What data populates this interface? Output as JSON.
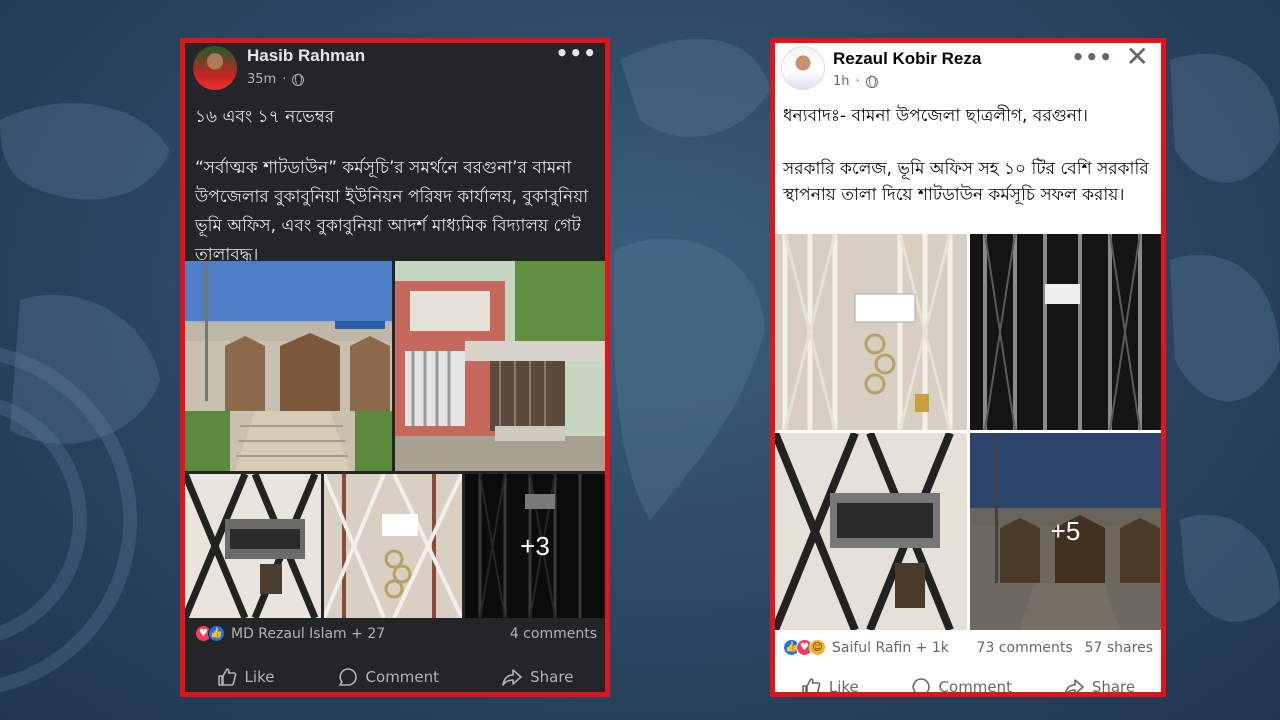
{
  "post1": {
    "author": "Hasib Rahman",
    "time": "35m",
    "paragraphs": [
      "১৬ এবং ১৭ নভেম্বর",
      "“সর্বাত্মক শাটডাউন” কর্মসূচি’র সমর্থনে বরগুনা’র বামনা উপজেলার বুকাবুনিয়া ইউনিয়ন পরিষদ কার্যালয়, বুকাবুনিয়া ভূমি অফিস, এবং বুকাবুনিয়া আদর্শ মাধ্যমিক বিদ্যালয় গেট তালাবদ্ধ।"
    ],
    "more_photos": "+3",
    "reactions_text": "MD Rezaul Islam + 27",
    "comments": "4 comments",
    "actions": {
      "like": "Like",
      "comment": "Comment",
      "share": "Share"
    }
  },
  "post2": {
    "author": "Rezaul Kobir Reza",
    "time": "1h",
    "paragraphs": [
      "ধন্যবাদঃ- বামনা উপজেলা ছাত্রলীগ, বরগুনা।",
      "সরকারি কলেজ, ভূমি অফিস সহ ১০ টির বেশি সরকারি স্থাপনায় তালা দিয়ে শাটডাউন কর্মসূচি সফল করায়।"
    ],
    "more_photos": "+5",
    "reactions_text": "Saiful Rafin + 1k",
    "comments": "73 comments",
    "shares": "57 shares",
    "actions": {
      "like": "Like",
      "comment": "Comment",
      "share": "Share"
    }
  },
  "icons": {
    "more": "more-dots-icon",
    "close": "close-icon",
    "globe": "globe-icon",
    "like": "like-icon",
    "comment": "comment-icon",
    "share": "share-icon"
  },
  "colors": {
    "frame": "#e0141b",
    "dark_card": "#242526",
    "like_blue": "#1877f2",
    "love_red": "#f33e58"
  }
}
